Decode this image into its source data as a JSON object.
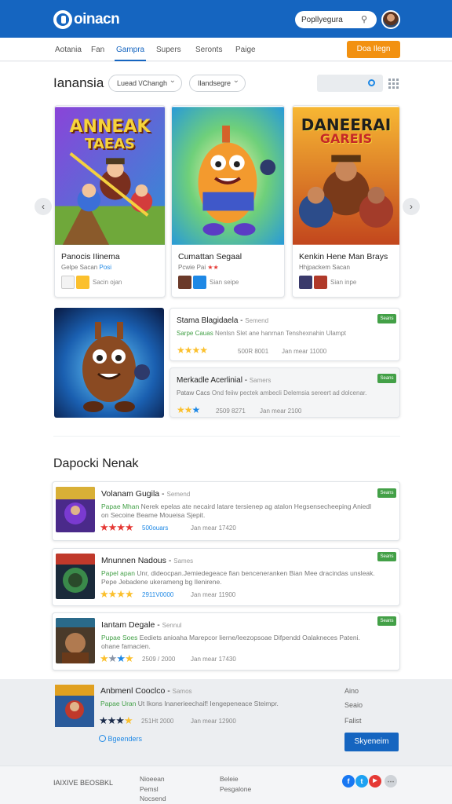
{
  "header": {
    "logo_text": "oinacn",
    "search_placeholder": "Popllyegura"
  },
  "nav": {
    "items": [
      "Aotania",
      "Fan",
      "Gampra",
      "Supers",
      "Seronts",
      "Paige"
    ],
    "active": "Gampra",
    "cta": "Doa Ilegn"
  },
  "featured": {
    "title": "Ianansia",
    "filters": [
      "Luead \\/Changh",
      "Ilandsegre"
    ],
    "cards": [
      {
        "art_text": [
          "ANNEAK",
          "TAEAS"
        ],
        "title": "Panocis IIinema",
        "meta": "Gelpe Sacan",
        "meta_extra": "Posi",
        "chip_meta": "Sacin ojan",
        "colors": {
          "bg1": "#7a3fcf",
          "bg2": "#2f8fd6",
          "ground": "#6fa83a"
        }
      },
      {
        "art_text": [],
        "title": "Cumattan Segaal",
        "meta": "Pcwie",
        "meta_extra": "Pai",
        "chip_meta": "Sian seipe",
        "colors": {
          "bg1": "#f3c23a",
          "bg2": "#4cc36d",
          "ground": "#3aa0d0"
        }
      },
      {
        "art_text": [
          "DANEERAI",
          "GAREIS"
        ],
        "title": "Kenkin Hene Man Brays",
        "meta": "Hhjpackem Sacan",
        "meta_extra": "",
        "chip_meta": "Sian inpe",
        "colors": {
          "bg1": "#f6a21d",
          "bg2": "#c84a1e",
          "ground": "#7a3a1a"
        }
      }
    ]
  },
  "spotlight": {
    "items": [
      {
        "title": "Stama Blagidaela",
        "sub": "Semend",
        "tag": "Sarpe Cauas",
        "desc": "Nenlsn Slet ane hanrnan Tenshexnahin Ulampt",
        "rating": 4,
        "num1": "500R 8001",
        "num2": "Jan mear 11000",
        "badge": "Seans"
      },
      {
        "title": "Merkadle Acerlinial",
        "sub": "Samers",
        "tag": "Pataw Cacs",
        "desc": "Ond feiiw pectek ambecli Delemsia sereert ad dolcenar.",
        "rating": 3,
        "num1": "2509 8271",
        "num2": "Jan mear 2100",
        "badge": "Seans"
      }
    ]
  },
  "popular": {
    "title": "Dapocki Nenak",
    "rows": [
      {
        "title": "Volanam Gugila",
        "sub": "Semend",
        "tag": "Papae Mhan",
        "desc": "Nerek epelas ate necaird latare tersienep ag atalon Hegsensecheeping Aniedl on Secoine Beame Moueisa Sjepit.",
        "rating": 4,
        "star_color": "#e53935",
        "num1": "500ouars",
        "num2": "Jan mear 17420",
        "badge": "Seans"
      },
      {
        "title": "Mnunnen Nadous",
        "sub": "Sames",
        "tag": "Papel apan",
        "desc": "Unr, dideocpan.Jemiedegeace fian benceneranken Bian Mee dracindas unsleak. Pepe Jebadene ukerameng bg Ilenirene.",
        "rating": 4,
        "star_color": "#fbc02d",
        "num1": "2911V0000",
        "num2": "Jan mear 11900",
        "badge": "Seans"
      },
      {
        "title": "Iantam Degale",
        "sub": "Sennul",
        "tag": "Pupae Soes",
        "desc": "Eediets anioaha Marepcor lierne/Ieezopsoae Difpendd Oalakneces Pateni. ohane famacien.",
        "rating": 3,
        "star_color": "#fbc02d",
        "num1": "2509 / 2000",
        "num2": "Jan mear 17430",
        "badge": "Seans"
      }
    ]
  },
  "promo": {
    "title": "Anbmenl Cooclco",
    "sub": "Samos",
    "tag": "Papae Uran",
    "desc": "Ut Ikons Inanerieechaif! Iengepeneace Steimpr.",
    "rating": 4,
    "num1": "251Ht 2000",
    "num2": "Jan mear 12900",
    "link": "Bgeenders",
    "side_links": [
      "Aino",
      "Seaio",
      "Falist"
    ],
    "button": "Skyeneim"
  },
  "footer": {
    "brand": "IAIXIVE BEOSBKL",
    "col1": [
      "Nioeean",
      "Pemsl",
      "Nocsend"
    ],
    "col2": [
      "Beleie",
      "Pesgalone"
    ],
    "social": [
      {
        "name": "facebook",
        "glyph": "f",
        "color": "#1877f2"
      },
      {
        "name": "twitter",
        "glyph": "t",
        "color": "#1da1f2"
      },
      {
        "name": "youtube",
        "glyph": "▶",
        "color": "#e53935"
      },
      {
        "name": "more",
        "glyph": "⋯",
        "color": "#9e9e9e"
      }
    ]
  }
}
